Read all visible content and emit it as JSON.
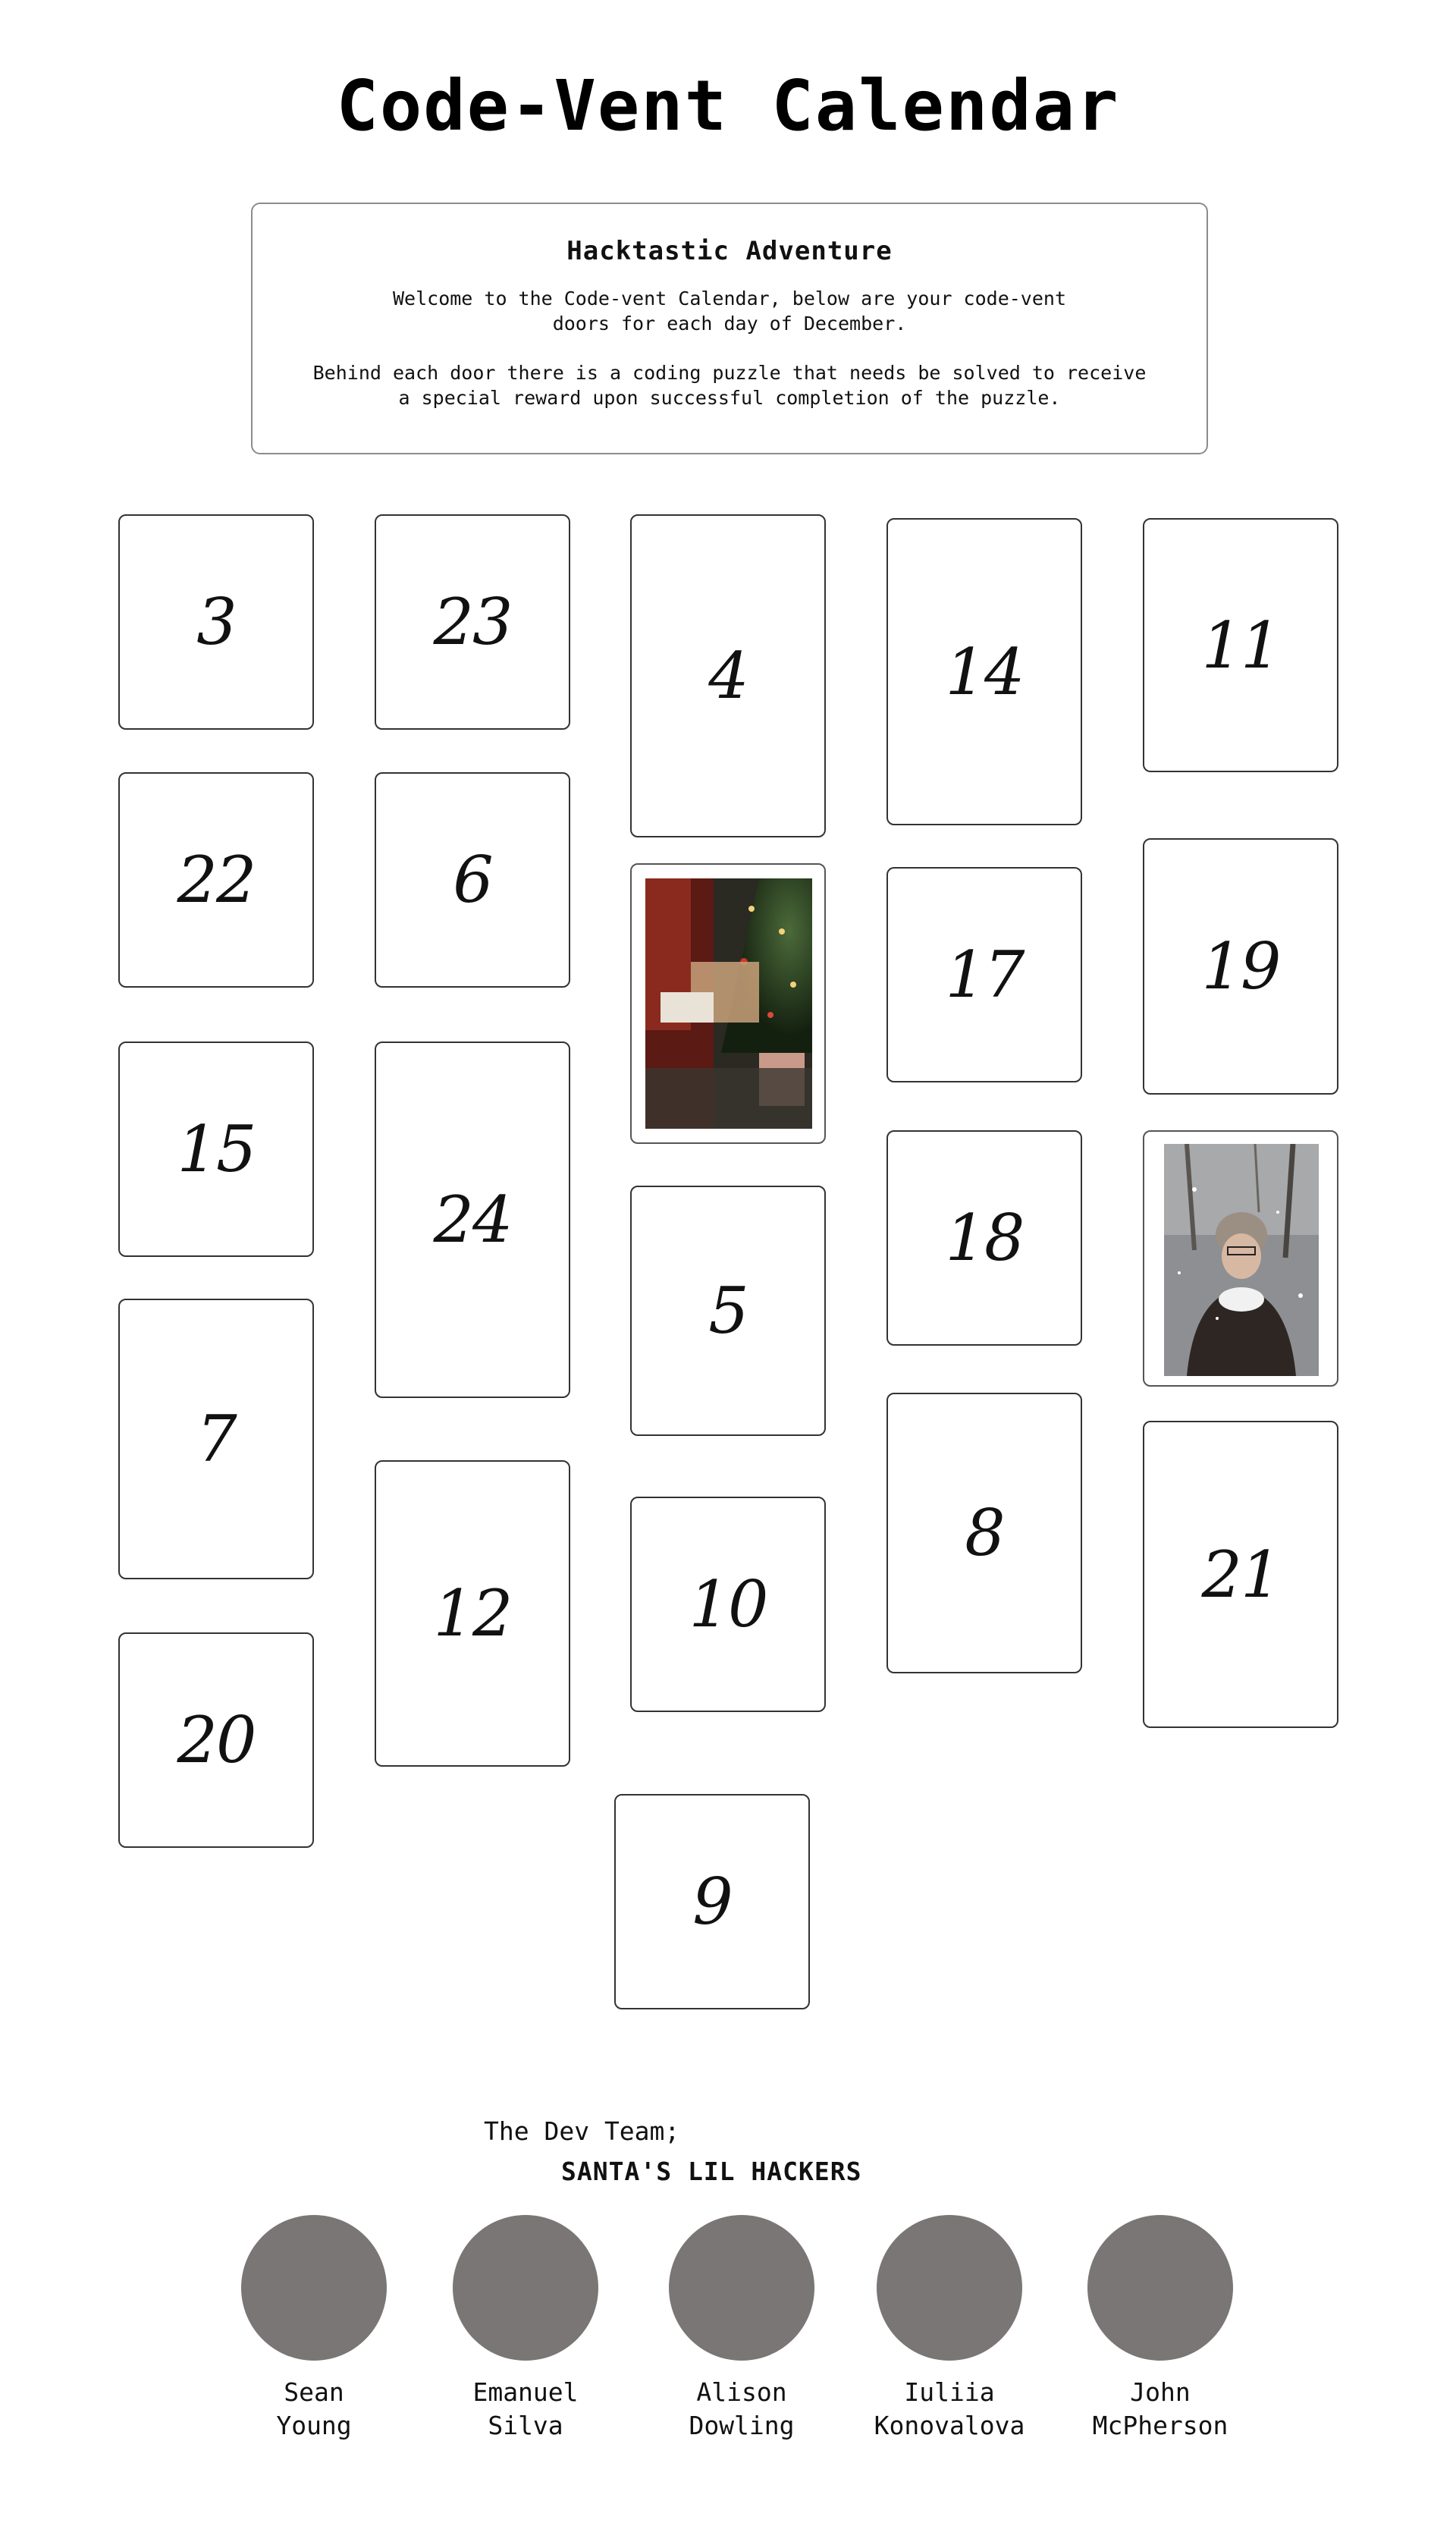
{
  "page": {
    "title": "Code-Vent Calendar"
  },
  "intro": {
    "heading": "Hacktastic Adventure",
    "paragraph1_line1": "Welcome to the Code-vent Calendar, below are your code-vent",
    "paragraph1_line2": "doors for each day of December.",
    "paragraph2_line1": "Behind each door there is a coding puzzle that needs be solved to receive",
    "paragraph2_line2": "a special reward upon successful completion of the puzzle."
  },
  "doors": [
    "3",
    "23",
    "4",
    "14",
    "11",
    "22",
    "6",
    "17",
    "19",
    "15",
    "24",
    "18",
    "7",
    "5",
    "8",
    "21",
    "20",
    "12",
    "10",
    "9"
  ],
  "team": {
    "label": "The Dev Team;",
    "name": "SANTA'S LIL HACKERS",
    "members": [
      {
        "first": "Sean",
        "last": "Young"
      },
      {
        "first": "Emanuel",
        "last": "Silva"
      },
      {
        "first": "Alison",
        "last": "Dowling"
      },
      {
        "first": "Iuliia",
        "last": "Konovalova"
      },
      {
        "first": "John",
        "last": "McPherson"
      }
    ]
  },
  "colors": {
    "avatar": "#7a7676",
    "border": "#333333"
  }
}
